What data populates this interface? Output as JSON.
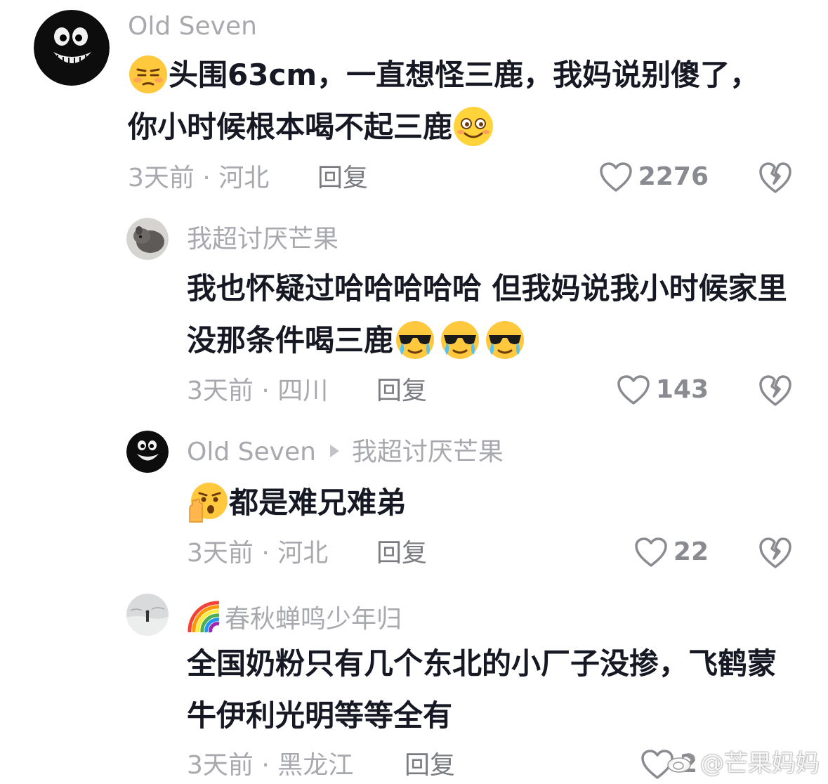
{
  "comments": [
    {
      "username": "Old Seven",
      "text_a": "头围63cm，一直想怪三鹿，我妈说别傻了，你小时候根本喝不起三鹿",
      "meta": "3天前 · 河北",
      "reply": "回复",
      "likes": "2276",
      "emoji_lead": "unamused-face",
      "emoji_tail": "smile-face"
    },
    {
      "username": "我超讨厌芒果",
      "text_a": "我也怀疑过哈哈哈哈哈 但我妈说我小时候家里没那条件喝三鹿",
      "meta": "3天前 · 四川",
      "reply": "回复",
      "likes": "143",
      "emoji_tail": "sunglasses-crying-face x3"
    },
    {
      "username": "Old Seven",
      "reply_to": "我超讨厌芒果",
      "text_a": "都是难兄难弟",
      "meta": "3天前 · 河北",
      "reply": "回复",
      "likes": "22",
      "emoji_lead": "shocked-hand-face"
    },
    {
      "username": "春秋蝉鸣少年归",
      "text_a": "全国奶粉只有几个东北的小厂子没掺，飞鹤蒙牛伊利光明等等全有",
      "meta": "3天前 · 黑龙江",
      "reply": "回复",
      "likes": "2",
      "username_prefix_icon": "rainbow"
    }
  ],
  "watermark": "@芒果妈妈",
  "colors": {
    "text": "#161823",
    "muted": "#a8a9ae",
    "emoji_yellow": "#ffc83d"
  }
}
